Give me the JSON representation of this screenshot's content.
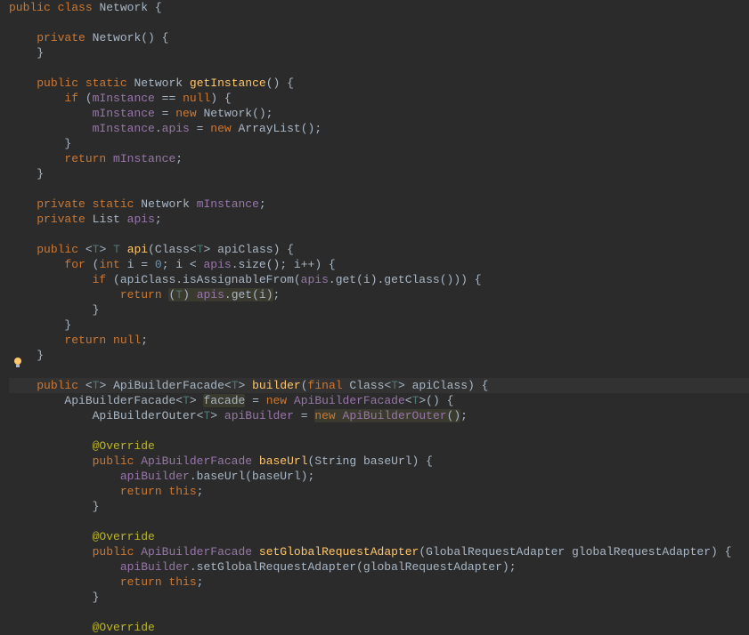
{
  "code": {
    "l1": {
      "kw1": "public",
      "kw2": "class",
      "name": "Network",
      "brace": " {"
    },
    "l2": "",
    "l3": {
      "indent": "    ",
      "kw1": "private",
      "name": "Network",
      "paren": "() {"
    },
    "l4": {
      "indent": "    ",
      "brace": "}"
    },
    "l5": "",
    "l6": {
      "indent": "    ",
      "kw1": "public",
      "kw2": "static",
      "type": "Network",
      "method": "getInstance",
      "paren": "() {"
    },
    "l7": {
      "indent": "        ",
      "kw": "if",
      "open": " (",
      "field": "mInstance",
      "op": " == ",
      "kw2": "null",
      "close": ") {"
    },
    "l8": {
      "indent": "            ",
      "field": "mInstance",
      "op": " = ",
      "kw": "new",
      "sp": " ",
      "type": "Network",
      "paren": "();"
    },
    "l9": {
      "indent": "            ",
      "field1": "mInstance",
      "dot": ".",
      "field2": "apis",
      "op": " = ",
      "kw": "new",
      "sp": " ",
      "type": "ArrayList",
      "paren": "();"
    },
    "l10": {
      "indent": "        ",
      "brace": "}"
    },
    "l11": {
      "indent": "        ",
      "kw": "return",
      "sp": " ",
      "field": "mInstance",
      "semi": ";"
    },
    "l12": {
      "indent": "    ",
      "brace": "}"
    },
    "l13": "",
    "l14": {
      "indent": "    ",
      "kw1": "private",
      "kw2": "static",
      "type": "Network",
      "field": "mInstance",
      "semi": ";"
    },
    "l15": {
      "indent": "    ",
      "kw1": "private",
      "type": "List",
      "field": "apis",
      "semi": ";"
    },
    "l16": "",
    "l17": {
      "indent": "    ",
      "kw1": "public",
      "open": " <",
      "tvar": "T",
      "close1": "> ",
      "tvar2": "T",
      "sp": " ",
      "method": "api",
      "popen": "(",
      "ptype": "Class",
      "pgen": "<",
      "tvar3": "T",
      "pgenc": "> ",
      "pname": "apiClass",
      "pclose": ") {"
    },
    "l18": {
      "indent": "        ",
      "kw": "for",
      "open": " (",
      "kw2": "int",
      "sp": " ",
      "var": "i = ",
      "num": "0",
      "semi": "; i < ",
      "field": "apis",
      "call": ".size(); i++) {"
    },
    "l19": {
      "indent": "            ",
      "kw": "if",
      "open": " (apiClass.isAssignableFrom(",
      "field": "apis",
      "call": ".get(i).getClass())) {"
    },
    "l20": {
      "indent": "                ",
      "kw": "return",
      "sp": " ",
      "cast1": "(",
      "tvar": "T",
      "cast2": ") ",
      "field": "apis",
      "call": ".get(i)",
      "semi": ";"
    },
    "l21": {
      "indent": "            ",
      "brace": "}"
    },
    "l22": {
      "indent": "        ",
      "brace": "}"
    },
    "l23": {
      "indent": "        ",
      "kw": "return",
      "sp": " ",
      "kw2": "null",
      "semi": ";"
    },
    "l24": {
      "indent": "    ",
      "brace": "}"
    },
    "l25": "",
    "l26": {
      "indent": "    ",
      "kw1": "public",
      "open": " <",
      "tvar": "T",
      "close1": "> ",
      "type": "ApiBuilderFacade",
      "gen": "<",
      "tvar2": "T",
      "genc": "> ",
      "method": "builder",
      "popen": "(",
      "kw2": "final",
      "sp2": " ",
      "ptype": "Class",
      "pgen": "<",
      "tvar3": "T",
      "pgenc": "> ",
      "pname": "apiClass",
      "pclose": ") {"
    },
    "l27": {
      "indent": "        ",
      "type": "ApiBuilderFacade",
      "gen": "<",
      "tvar": "T",
      "genc": "> ",
      "var": "facade",
      "op": " = ",
      "kw": "new",
      "sp": " ",
      "type2": "ApiBuilderFacade",
      "gen2": "<",
      "tvar2": "T",
      "genc2": ">() {"
    },
    "l28": {
      "indent": "            ",
      "type": "ApiBuilderOuter",
      "gen": "<",
      "tvar": "T",
      "genc": "> ",
      "var": "apiBuilder",
      "op": " = ",
      "kw": "new",
      "sp": " ",
      "type2": "ApiBuilderOuter",
      "paren": "()",
      "semi": ";"
    },
    "l29": "",
    "l30": {
      "indent": "            ",
      "anno": "@Override"
    },
    "l31": {
      "indent": "            ",
      "kw1": "public",
      "type": "ApiBuilderFacade",
      "method": "baseUrl",
      "popen": "(",
      "ptype": "String",
      "pname": "baseUrl",
      "pclose": ") {"
    },
    "l32": {
      "indent": "                ",
      "field": "apiBuilder",
      "call": ".baseUrl(baseUrl)",
      "semi": ";"
    },
    "l33": {
      "indent": "                ",
      "kw": "return",
      "sp": " ",
      "kw2": "this",
      "semi": ";"
    },
    "l34": {
      "indent": "            ",
      "brace": "}"
    },
    "l35": "",
    "l36": {
      "indent": "            ",
      "anno": "@Override"
    },
    "l37": {
      "indent": "            ",
      "kw1": "public",
      "type": "ApiBuilderFacade",
      "method": "setGlobalRequestAdapter",
      "popen": "(",
      "ptype": "GlobalRequestAdapter",
      "pname": "globalRequestAdapter",
      "pclose": ") {"
    },
    "l38": {
      "indent": "                ",
      "field": "apiBuilder",
      "call": ".setGlobalRequestAdapter(globalRequestAdapter)",
      "semi": ";"
    },
    "l39": {
      "indent": "                ",
      "kw": "return",
      "sp": " ",
      "kw2": "this",
      "semi": ";"
    },
    "l40": {
      "indent": "            ",
      "brace": "}"
    },
    "l41": "",
    "l42": {
      "indent": "            ",
      "anno": "@Override"
    }
  }
}
